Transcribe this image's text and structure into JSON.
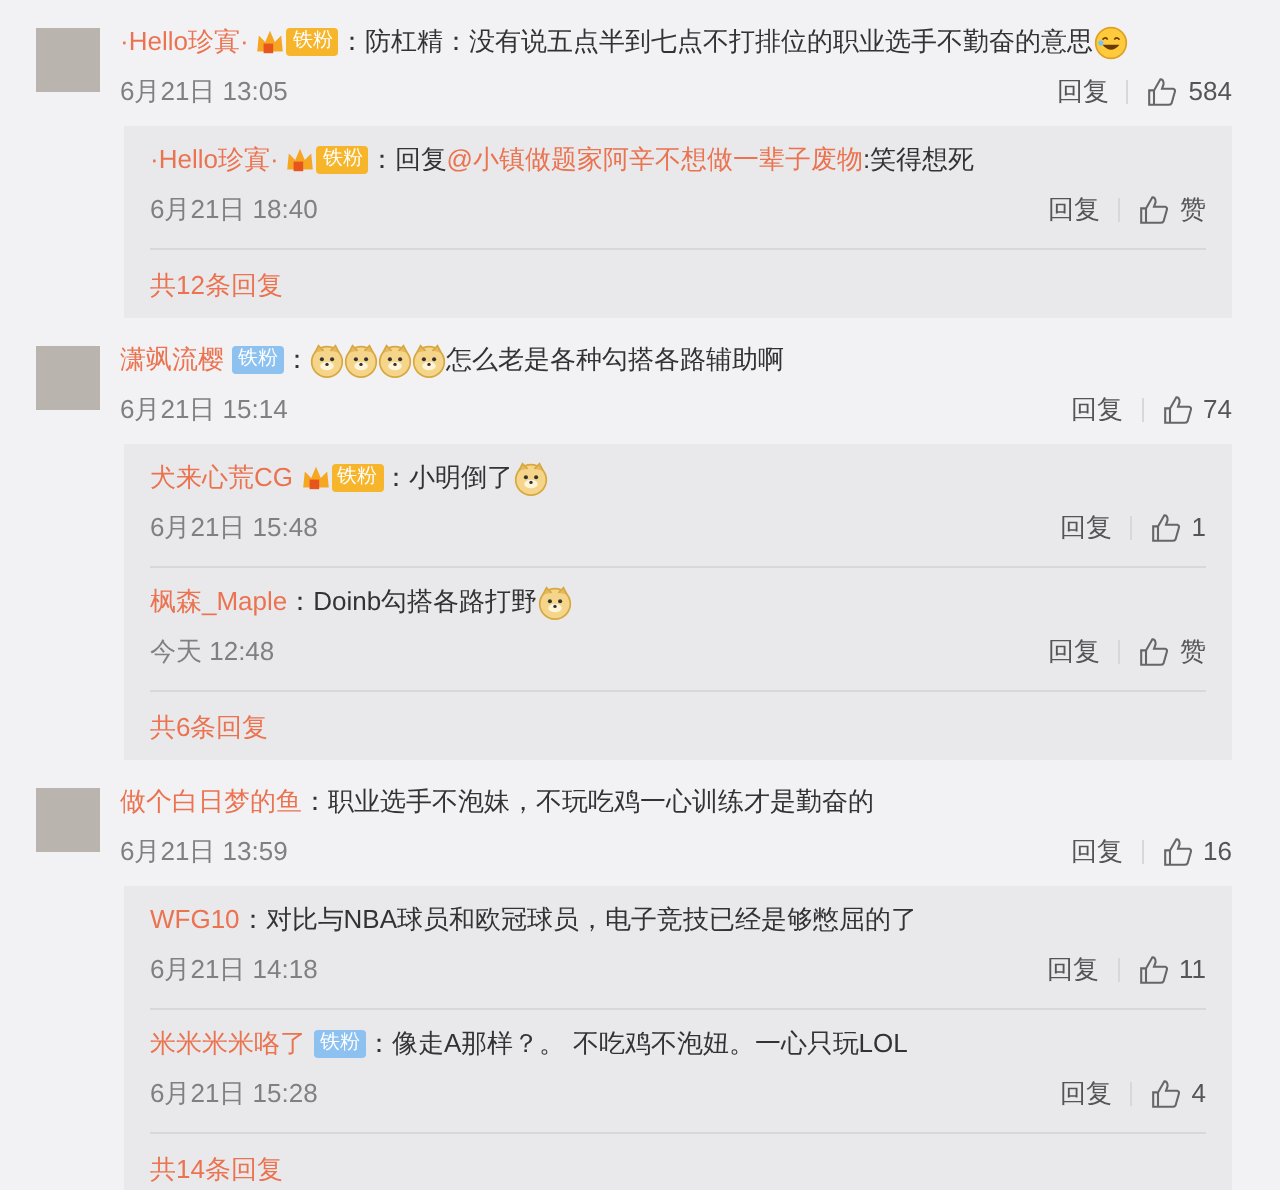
{
  "comments": [
    {
      "name": "·Hello珍寘·",
      "badge": {
        "kind": "gold",
        "label": "铁粉"
      },
      "segments": [
        {
          "kind": "text",
          "text": "：防杠精：没有说五点半到七点不打排位的职业选手不勤奋的意思"
        },
        {
          "kind": "laugh"
        }
      ],
      "time": "6月21日 13:05",
      "reply_label": "回复",
      "likes": "584",
      "replies": [
        {
          "name": "·Hello珍寘·",
          "badge": {
            "kind": "gold",
            "label": "铁粉"
          },
          "segments": [
            {
              "kind": "text",
              "text": "：回复"
            },
            {
              "kind": "mention",
              "text": "@小镇做题家阿辛不想做一辈子废物"
            },
            {
              "kind": "text",
              "text": ":笑得想死"
            }
          ],
          "time": "6月21日 18:40",
          "reply_label": "回复",
          "likes": "赞"
        }
      ],
      "more": "共12条回复"
    },
    {
      "name": "潇飒流樱",
      "badge": {
        "kind": "blue",
        "label": "铁粉"
      },
      "segments": [
        {
          "kind": "text",
          "text": "："
        },
        {
          "kind": "doge"
        },
        {
          "kind": "doge"
        },
        {
          "kind": "doge"
        },
        {
          "kind": "doge"
        },
        {
          "kind": "text",
          "text": "怎么老是各种勾搭各路辅助啊"
        }
      ],
      "time": "6月21日 15:14",
      "reply_label": "回复",
      "likes": "74",
      "replies": [
        {
          "name": "犬来心荒CG",
          "badge": {
            "kind": "gold",
            "label": "铁粉"
          },
          "segments": [
            {
              "kind": "text",
              "text": "：小明倒了"
            },
            {
              "kind": "doge"
            }
          ],
          "time": "6月21日 15:48",
          "reply_label": "回复",
          "likes": "1"
        },
        {
          "name": "枫森_Maple",
          "segments": [
            {
              "kind": "text",
              "text": "：Doinb勾搭各路打野"
            },
            {
              "kind": "doge"
            }
          ],
          "time": "今天 12:48",
          "reply_label": "回复",
          "likes": "赞"
        }
      ],
      "more": "共6条回复"
    },
    {
      "name": "做个白日梦的鱼",
      "segments": [
        {
          "kind": "text",
          "text": "：职业选手不泡妹，不玩吃鸡一心训练才是勤奋的"
        }
      ],
      "time": "6月21日 13:59",
      "reply_label": "回复",
      "likes": "16",
      "replies": [
        {
          "name": "WFG10",
          "segments": [
            {
              "kind": "text",
              "text": "：对比与NBA球员和欧冠球员，电子竞技已经是够憋屈的了"
            }
          ],
          "time": "6月21日 14:18",
          "reply_label": "回复",
          "likes": "11"
        },
        {
          "name": "米米米米咯了",
          "badge": {
            "kind": "blue",
            "label": "铁粉"
          },
          "segments": [
            {
              "kind": "text",
              "text": "：像走A那样？。 不吃鸡不泡妞。一心只玩LOL"
            }
          ],
          "time": "6月21日 15:28",
          "reply_label": "回复",
          "likes": "4"
        }
      ],
      "more": "共14条回复"
    }
  ]
}
